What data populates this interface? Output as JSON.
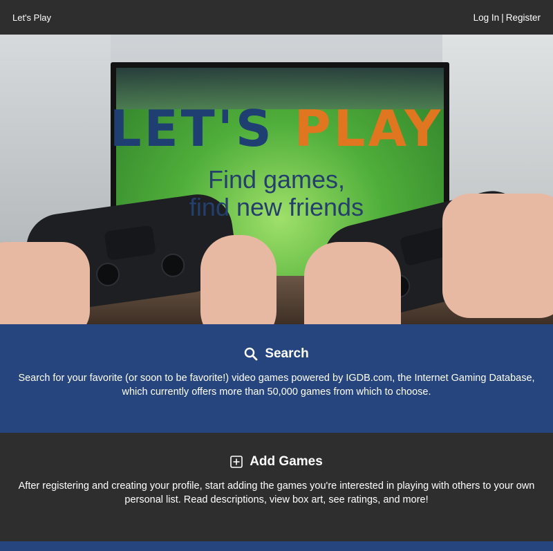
{
  "navbar": {
    "brand": "Let's Play",
    "login": "Log In",
    "separator": "|",
    "register": "Register"
  },
  "hero": {
    "logo_part1": "LET'S",
    "logo_part2": "PLAY",
    "tagline_line1": "Find games,",
    "tagline_line2": "find new friends"
  },
  "features": {
    "search": {
      "icon": "search-icon",
      "title": "Search",
      "description": "Search for your favorite (or soon to be favorite!) video games powered by IGDB.com, the Internet Gaming Database, which currently offers more than 50,000 games from which to choose."
    },
    "add_games": {
      "icon": "plus-square-icon",
      "title": "Add Games",
      "description": "After registering and creating your profile, start adding the games you're interested in playing with others to your own personal list. Read descriptions, view box art, see ratings, and more!"
    }
  },
  "colors": {
    "navbar_bg": "#2e2e2e",
    "blue_section": "#26457e",
    "dark_section": "#2e2e2e",
    "logo_blue": "#1f3f73",
    "logo_orange": "#e0761f"
  }
}
